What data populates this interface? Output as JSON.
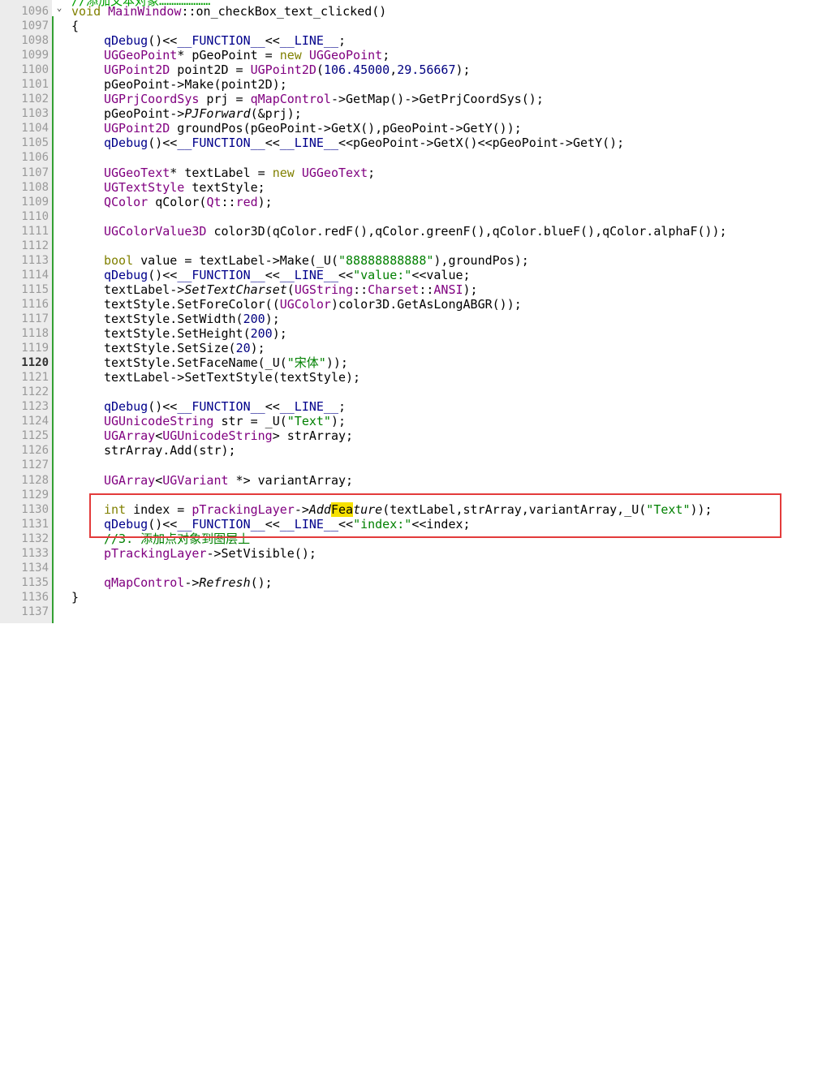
{
  "editor": {
    "top_comment": "//添加文本对象…………………",
    "current_line": "1120"
  },
  "lines": [
    {
      "n": "1096",
      "segs": [
        [
          "k",
          "void "
        ],
        [
          "t",
          "MainWindow"
        ],
        [
          "",
          "::on_checkBox_text_clicked()"
        ]
      ],
      "indent": 0
    },
    {
      "n": "1097",
      "segs": [
        [
          "",
          "{"
        ]
      ],
      "indent": 0
    },
    {
      "n": "1098",
      "segs": [
        [
          "f",
          "qDebug"
        ],
        [
          "",
          "()<<"
        ],
        [
          "f",
          "__FUNCTION__"
        ],
        [
          "",
          "<<"
        ],
        [
          "f",
          "__LINE__"
        ],
        [
          "",
          ";"
        ]
      ],
      "indent": 1
    },
    {
      "n": "1099",
      "segs": [
        [
          "t",
          "UGGeoPoint"
        ],
        [
          "",
          "* pGeoPoint = "
        ],
        [
          "k",
          "new "
        ],
        [
          "t",
          "UGGeoPoint"
        ],
        [
          "",
          ";"
        ]
      ],
      "indent": 1
    },
    {
      "n": "1100",
      "segs": [
        [
          "t",
          "UGPoint2D"
        ],
        [
          "",
          " point2D = "
        ],
        [
          "t",
          "UGPoint2D"
        ],
        [
          "",
          "("
        ],
        [
          "n",
          "106.45000"
        ],
        [
          "",
          ","
        ],
        [
          "n",
          "29.56667"
        ],
        [
          "",
          ");"
        ]
      ],
      "indent": 1
    },
    {
      "n": "1101",
      "segs": [
        [
          "",
          "pGeoPoint->Make(point2D);"
        ]
      ],
      "indent": 1
    },
    {
      "n": "1102",
      "segs": [
        [
          "t",
          "UGPrjCoordSys"
        ],
        [
          "",
          " prj = "
        ],
        [
          "t",
          "qMapControl"
        ],
        [
          "",
          "->GetMap()->GetPrjCoordSys();"
        ]
      ],
      "indent": 1
    },
    {
      "n": "1103",
      "segs": [
        [
          "",
          "pGeoPoint->"
        ],
        [
          "i",
          "PJForward"
        ],
        [
          "",
          "(&prj);"
        ]
      ],
      "indent": 1
    },
    {
      "n": "1104",
      "segs": [
        [
          "t",
          "UGPoint2D"
        ],
        [
          "",
          " groundPos(pGeoPoint->GetX(),pGeoPoint->GetY());"
        ]
      ],
      "indent": 1
    },
    {
      "n": "1105",
      "segs": [
        [
          "f",
          "qDebug"
        ],
        [
          "",
          "()<<"
        ],
        [
          "f",
          "__FUNCTION__"
        ],
        [
          "",
          "<<"
        ],
        [
          "f",
          "__LINE__"
        ],
        [
          "",
          "<<pGeoPoint->GetX()<<pGeoPoint->GetY();"
        ]
      ],
      "indent": 1
    },
    {
      "n": "1106",
      "segs": [],
      "indent": 0
    },
    {
      "n": "1107",
      "segs": [
        [
          "t",
          "UGGeoText"
        ],
        [
          "",
          "* textLabel = "
        ],
        [
          "k",
          "new "
        ],
        [
          "t",
          "UGGeoText"
        ],
        [
          "",
          ";"
        ]
      ],
      "indent": 1
    },
    {
      "n": "1108",
      "segs": [
        [
          "t",
          "UGTextStyle"
        ],
        [
          "",
          " textStyle;"
        ]
      ],
      "indent": 1
    },
    {
      "n": "1109",
      "segs": [
        [
          "t",
          "QColor"
        ],
        [
          "",
          " qColor("
        ],
        [
          "t",
          "Qt"
        ],
        [
          "",
          "::"
        ],
        [
          "t",
          "red"
        ],
        [
          "",
          ");"
        ]
      ],
      "indent": 1
    },
    {
      "n": "1110",
      "segs": [],
      "indent": 0
    },
    {
      "n": "1111",
      "segs": [
        [
          "t",
          "UGColorValue3D"
        ],
        [
          "",
          " color3D(qColor.redF(),qColor.greenF(),qColor.blueF(),qColor.alphaF());"
        ]
      ],
      "indent": 1
    },
    {
      "n": "1112",
      "segs": [],
      "indent": 0
    },
    {
      "n": "1113",
      "segs": [
        [
          "k",
          "bool"
        ],
        [
          "",
          " value = textLabel->Make(_U("
        ],
        [
          "s",
          "\"88888888888\""
        ],
        [
          "",
          "),groundPos);"
        ]
      ],
      "indent": 1
    },
    {
      "n": "1114",
      "segs": [
        [
          "f",
          "qDebug"
        ],
        [
          "",
          "()<<"
        ],
        [
          "f",
          "__FUNCTION__"
        ],
        [
          "",
          "<<"
        ],
        [
          "f",
          "__LINE__"
        ],
        [
          "",
          "<<"
        ],
        [
          "s",
          "\"value:\""
        ],
        [
          "",
          "<<value;"
        ]
      ],
      "indent": 1
    },
    {
      "n": "1115",
      "segs": [
        [
          "",
          "textLabel->"
        ],
        [
          "i",
          "SetTextCharset"
        ],
        [
          "",
          "("
        ],
        [
          "t",
          "UGString"
        ],
        [
          "",
          "::"
        ],
        [
          "t",
          "Charset"
        ],
        [
          "",
          "::"
        ],
        [
          "t",
          "ANSI"
        ],
        [
          "",
          ");"
        ]
      ],
      "indent": 1
    },
    {
      "n": "1116",
      "segs": [
        [
          "",
          "textStyle.SetForeColor(("
        ],
        [
          "t",
          "UGColor"
        ],
        [
          "",
          ")color3D.GetAsLongABGR());"
        ]
      ],
      "indent": 1
    },
    {
      "n": "1117",
      "segs": [
        [
          "",
          "textStyle.SetWidth("
        ],
        [
          "n",
          "200"
        ],
        [
          "",
          ");"
        ]
      ],
      "indent": 1
    },
    {
      "n": "1118",
      "segs": [
        [
          "",
          "textStyle.SetHeight("
        ],
        [
          "n",
          "200"
        ],
        [
          "",
          ");"
        ]
      ],
      "indent": 1
    },
    {
      "n": "1119",
      "segs": [
        [
          "",
          "textStyle.SetSize("
        ],
        [
          "n",
          "20"
        ],
        [
          "",
          ");"
        ]
      ],
      "indent": 1
    },
    {
      "n": "1120",
      "segs": [
        [
          "",
          "textStyle.SetFaceName(_U("
        ],
        [
          "s",
          "\"宋体\""
        ],
        [
          "",
          "));"
        ]
      ],
      "indent": 1
    },
    {
      "n": "1121",
      "segs": [
        [
          "",
          "textLabel->SetTextStyle(textStyle);"
        ]
      ],
      "indent": 1
    },
    {
      "n": "1122",
      "segs": [],
      "indent": 0
    },
    {
      "n": "1123",
      "segs": [
        [
          "f",
          "qDebug"
        ],
        [
          "",
          "()<<"
        ],
        [
          "f",
          "__FUNCTION__"
        ],
        [
          "",
          "<<"
        ],
        [
          "f",
          "__LINE__"
        ],
        [
          "",
          ";"
        ]
      ],
      "indent": 1
    },
    {
      "n": "1124",
      "segs": [
        [
          "t",
          "UGUnicodeString"
        ],
        [
          "",
          " str = _U("
        ],
        [
          "s",
          "\"Text\""
        ],
        [
          "",
          ");"
        ]
      ],
      "indent": 1
    },
    {
      "n": "1125",
      "segs": [
        [
          "t",
          "UGArray"
        ],
        [
          "",
          "<"
        ],
        [
          "t",
          "UGUnicodeString"
        ],
        [
          "",
          "> strArray;"
        ]
      ],
      "indent": 1
    },
    {
      "n": "1126",
      "segs": [
        [
          "",
          "strArray.Add(str);"
        ]
      ],
      "indent": 1
    },
    {
      "n": "1127",
      "segs": [],
      "indent": 0
    },
    {
      "n": "1128",
      "segs": [
        [
          "t",
          "UGArray"
        ],
        [
          "",
          "<"
        ],
        [
          "t",
          "UGVariant"
        ],
        [
          "",
          " *> variantArray;"
        ]
      ],
      "indent": 1
    },
    {
      "n": "1129",
      "segs": [],
      "indent": 0
    },
    {
      "n": "1130",
      "segs": [
        [
          "k",
          "int"
        ],
        [
          "",
          " index = "
        ],
        [
          "t",
          "pTrackingLayer"
        ],
        [
          "",
          "->"
        ],
        [
          "i",
          "Add"
        ],
        [
          "hl",
          "Fea"
        ],
        [
          "i",
          "ture"
        ],
        [
          "",
          "(textLabel,strArray,variantArray,_U("
        ],
        [
          "s",
          "\"Text\""
        ],
        [
          "",
          "));"
        ]
      ],
      "indent": 1
    },
    {
      "n": "1131",
      "segs": [
        [
          "f",
          "qDebug"
        ],
        [
          "",
          "()<<"
        ],
        [
          "f",
          "__FUNCTION__"
        ],
        [
          "",
          "<<"
        ],
        [
          "f",
          "__LINE__"
        ],
        [
          "",
          "<<"
        ],
        [
          "s",
          "\"index:\""
        ],
        [
          "",
          "<<index;"
        ]
      ],
      "indent": 1
    },
    {
      "n": "1132",
      "segs": [
        [
          "c",
          "//3. 添加点对象到图层上"
        ]
      ],
      "indent": 1
    },
    {
      "n": "1133",
      "segs": [
        [
          "t",
          "pTrackingLayer"
        ],
        [
          "",
          "->SetVisible();"
        ]
      ],
      "indent": 1
    },
    {
      "n": "1134",
      "segs": [],
      "indent": 0
    },
    {
      "n": "1135",
      "segs": [
        [
          "t",
          "qMapControl"
        ],
        [
          "",
          "->"
        ],
        [
          "i",
          "Refresh"
        ],
        [
          "",
          "();"
        ]
      ],
      "indent": 1
    },
    {
      "n": "1136",
      "segs": [
        [
          "",
          "}"
        ]
      ],
      "indent": 0
    },
    {
      "n": "1137",
      "segs": [],
      "indent": 0
    }
  ],
  "colors": {
    "highlight_box": "#e33b3b",
    "search_highlight": "#f6e000",
    "fold_line": "#33a033"
  },
  "icons": {
    "fold": "chevron-down-icon"
  }
}
